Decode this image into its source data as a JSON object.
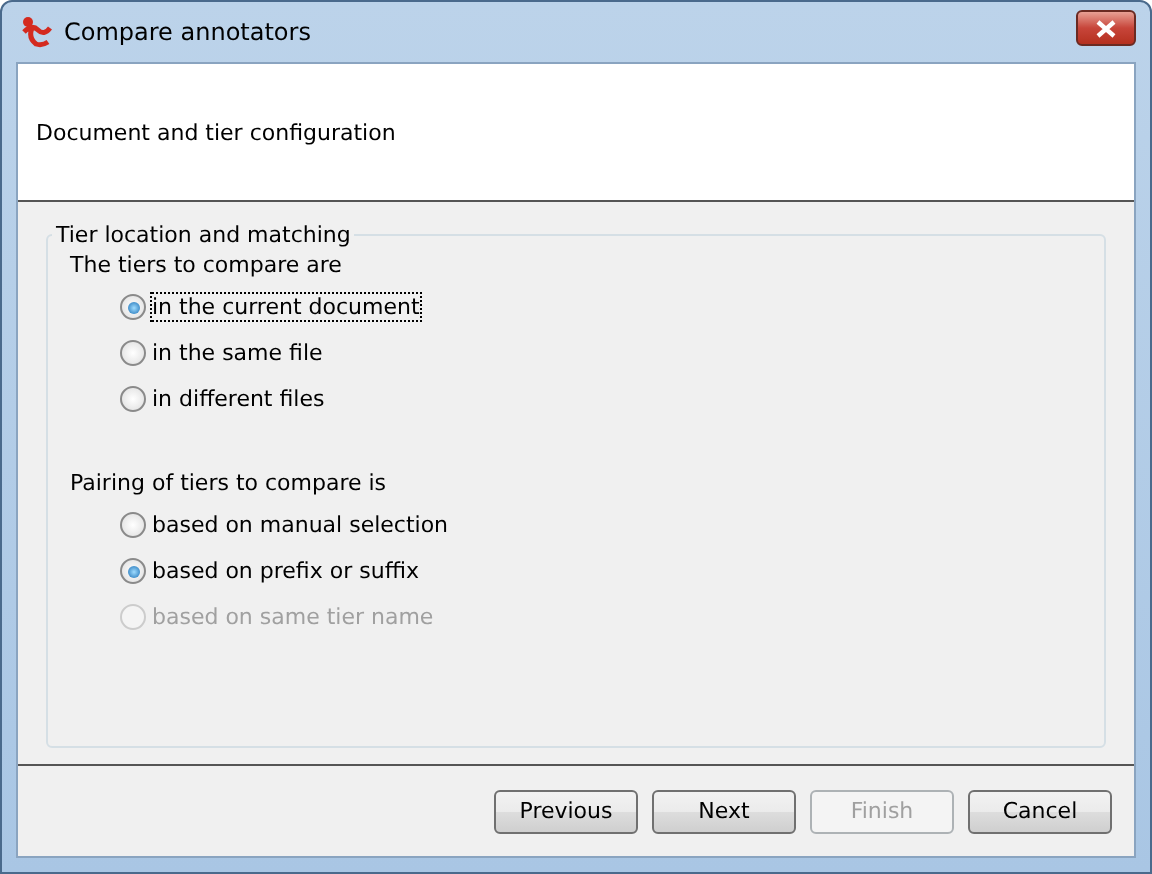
{
  "window": {
    "title": "Compare annotators"
  },
  "header": {
    "text": "Document and tier configuration"
  },
  "group": {
    "legend": "Tier location and matching",
    "sections": [
      {
        "label": "The tiers to compare are",
        "options": [
          {
            "label": "in the current document",
            "selected": true,
            "disabled": false,
            "focused": true
          },
          {
            "label": "in the same file",
            "selected": false,
            "disabled": false,
            "focused": false
          },
          {
            "label": "in different files",
            "selected": false,
            "disabled": false,
            "focused": false
          }
        ]
      },
      {
        "label": "Pairing of tiers to compare is",
        "options": [
          {
            "label": "based on manual selection",
            "selected": false,
            "disabled": false,
            "focused": false
          },
          {
            "label": "based on prefix or suffix",
            "selected": true,
            "disabled": false,
            "focused": false
          },
          {
            "label": "based on same tier name",
            "selected": false,
            "disabled": true,
            "focused": false
          }
        ]
      }
    ]
  },
  "buttons": [
    {
      "label": "Previous",
      "disabled": false
    },
    {
      "label": "Next",
      "disabled": false
    },
    {
      "label": "Finish",
      "disabled": true
    },
    {
      "label": "Cancel",
      "disabled": false
    }
  ]
}
